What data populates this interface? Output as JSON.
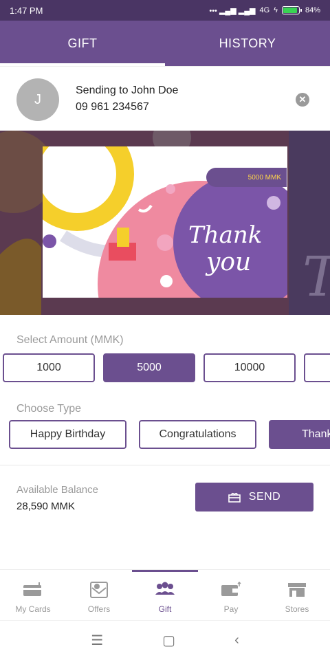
{
  "status_bar": {
    "time": "1:47 PM",
    "network": "4G",
    "battery": "84%"
  },
  "tabs": [
    {
      "label": "GIFT",
      "active": true
    },
    {
      "label": "HISTORY",
      "active": false
    }
  ],
  "recipient": {
    "initial": "J",
    "sending_to": "Sending to  John Doe",
    "phone": "09 961 234567"
  },
  "banner": {
    "amount_tag": "5000 MMK",
    "card_text": "Thank you"
  },
  "select_amount": {
    "label": "Select Amount (MMK)",
    "options": [
      "1000",
      "5000",
      "10000",
      ""
    ],
    "selected": "5000"
  },
  "choose_type": {
    "label": "Choose Type",
    "options": [
      "Happy Birthday",
      "Congratulations",
      "Thank"
    ],
    "selected": "Thank"
  },
  "balance": {
    "label": "Available Balance",
    "value": "28,590 MMK"
  },
  "send_button": {
    "label": "SEND",
    "icon": "gift-icon"
  },
  "bottom_nav": [
    {
      "label": "My Cards",
      "icon": "cards-icon",
      "active": false
    },
    {
      "label": "Offers",
      "icon": "offers-icon",
      "active": false
    },
    {
      "label": "Gift",
      "icon": "gift-group-icon",
      "active": true
    },
    {
      "label": "Pay",
      "icon": "wallet-icon",
      "active": false
    },
    {
      "label": "Stores",
      "icon": "store-icon",
      "active": false
    }
  ],
  "colors": {
    "primary": "#6b4f8f",
    "status_bar": "#4a3564"
  }
}
